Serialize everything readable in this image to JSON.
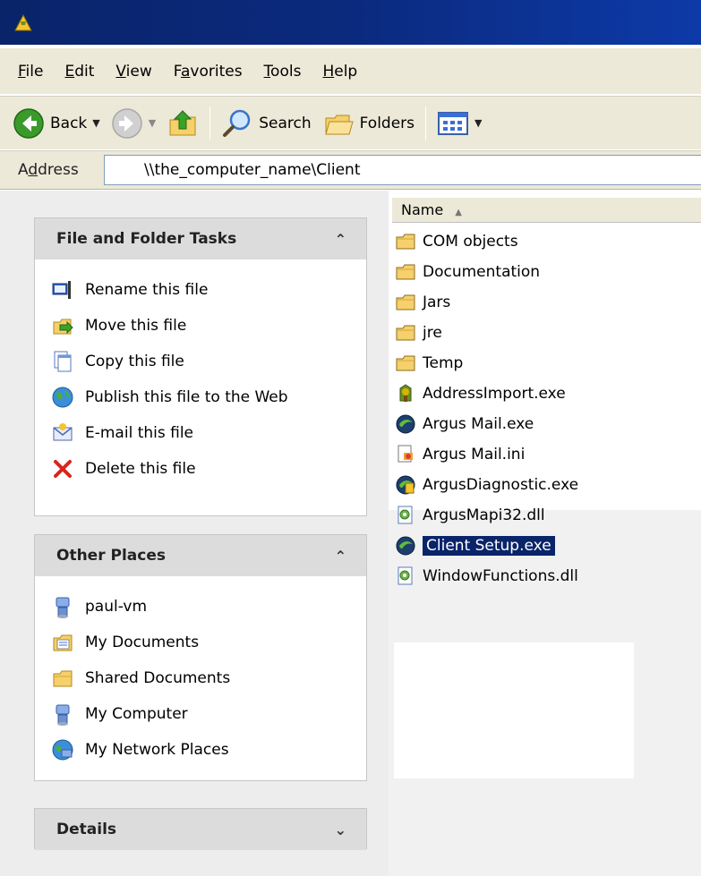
{
  "menubar": {
    "items": [
      {
        "accel": "F",
        "rest": "ile"
      },
      {
        "accel": "E",
        "rest": "dit"
      },
      {
        "accel": "V",
        "rest": "iew"
      },
      {
        "pre": "F",
        "accel": "a",
        "rest": "vorites"
      },
      {
        "accel": "T",
        "rest": "ools"
      },
      {
        "accel": "H",
        "rest": "elp"
      }
    ]
  },
  "toolbar": {
    "back_label": "Back",
    "search_label": "Search",
    "folders_label": "Folders"
  },
  "address": {
    "label_pre": "A",
    "label_acc": "d",
    "label_rest": "dress",
    "value": "\\\\the_computer_name\\Client"
  },
  "tasks_panel": {
    "title": "File and Folder Tasks",
    "items": [
      {
        "label": "Rename this file",
        "icon": "rename-icon"
      },
      {
        "label": "Move this file",
        "icon": "move-icon"
      },
      {
        "label": "Copy this file",
        "icon": "copy-icon"
      },
      {
        "label": "Publish this file to the Web",
        "icon": "publish-web-icon"
      },
      {
        "label": "E-mail this file",
        "icon": "email-icon"
      },
      {
        "label": "Delete this file",
        "icon": "delete-icon"
      }
    ]
  },
  "places_panel": {
    "title": "Other Places",
    "items": [
      {
        "label": "paul-vm",
        "icon": "computer-icon"
      },
      {
        "label": "My Documents",
        "icon": "my-documents-icon"
      },
      {
        "label": "Shared Documents",
        "icon": "folder-icon"
      },
      {
        "label": "My Computer",
        "icon": "computer-icon"
      },
      {
        "label": "My Network Places",
        "icon": "network-icon"
      }
    ]
  },
  "details_panel": {
    "title": "Details"
  },
  "file_list": {
    "column_name": "Name",
    "files": [
      {
        "name": "COM objects",
        "type": "folder"
      },
      {
        "name": "Documentation",
        "type": "folder"
      },
      {
        "name": "Jars",
        "type": "folder"
      },
      {
        "name": "jre",
        "type": "folder"
      },
      {
        "name": "Temp",
        "type": "folder"
      },
      {
        "name": "AddressImport.exe",
        "type": "exe-address"
      },
      {
        "name": "Argus Mail.exe",
        "type": "exe-argus"
      },
      {
        "name": "Argus Mail.ini",
        "type": "ini"
      },
      {
        "name": "ArgusDiagnostic.exe",
        "type": "exe-diagnostic"
      },
      {
        "name": "ArgusMapi32.dll",
        "type": "dll"
      },
      {
        "name": "Client Setup.exe",
        "type": "exe-argus",
        "selected": true
      },
      {
        "name": "WindowFunctions.dll",
        "type": "dll"
      }
    ]
  },
  "colors": {
    "titlebar": "#0a246a",
    "selection": "#0a246a",
    "chrome": "#ece9d8"
  }
}
